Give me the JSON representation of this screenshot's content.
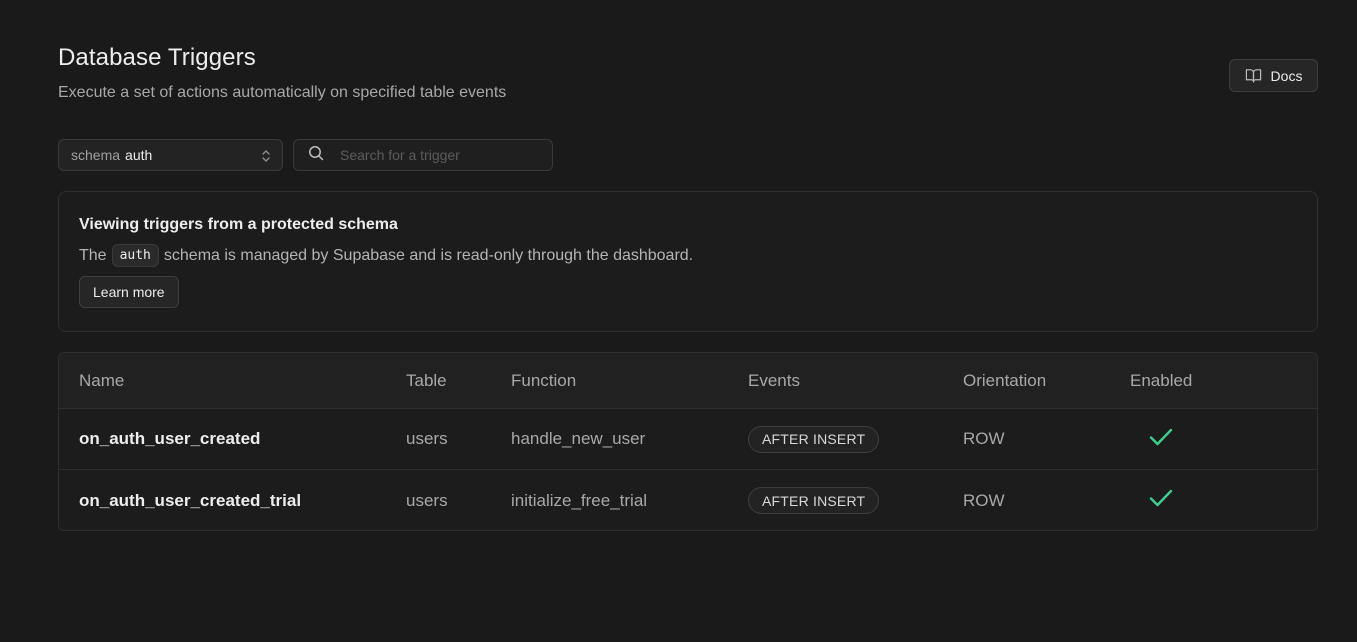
{
  "header": {
    "title": "Database Triggers",
    "subtitle": "Execute a set of actions automatically on specified table events",
    "docs_label": "Docs"
  },
  "filters": {
    "schema_prefix": "schema",
    "schema_value": "auth",
    "search_placeholder": "Search for a trigger"
  },
  "notice": {
    "title": "Viewing triggers from a protected schema",
    "body_before": "The",
    "code": "auth",
    "body_after": "schema is managed by Supabase and is read-only through the dashboard.",
    "learn_more": "Learn more"
  },
  "table": {
    "columns": [
      "Name",
      "Table",
      "Function",
      "Events",
      "Orientation",
      "Enabled"
    ],
    "rows": [
      {
        "name": "on_auth_user_created",
        "table": "users",
        "function": "handle_new_user",
        "events": "AFTER INSERT",
        "orientation": "ROW",
        "enabled": true
      },
      {
        "name": "on_auth_user_created_trial",
        "table": "users",
        "function": "initialize_free_trial",
        "events": "AFTER INSERT",
        "orientation": "ROW",
        "enabled": true
      }
    ]
  },
  "icons": {
    "docs": "book-open-icon",
    "select": "chevrons-up-down-icon",
    "search": "search-icon",
    "enabled": "check-icon"
  },
  "colors": {
    "background": "#1a1a1a",
    "enabled_check": "#3ecf8e"
  }
}
